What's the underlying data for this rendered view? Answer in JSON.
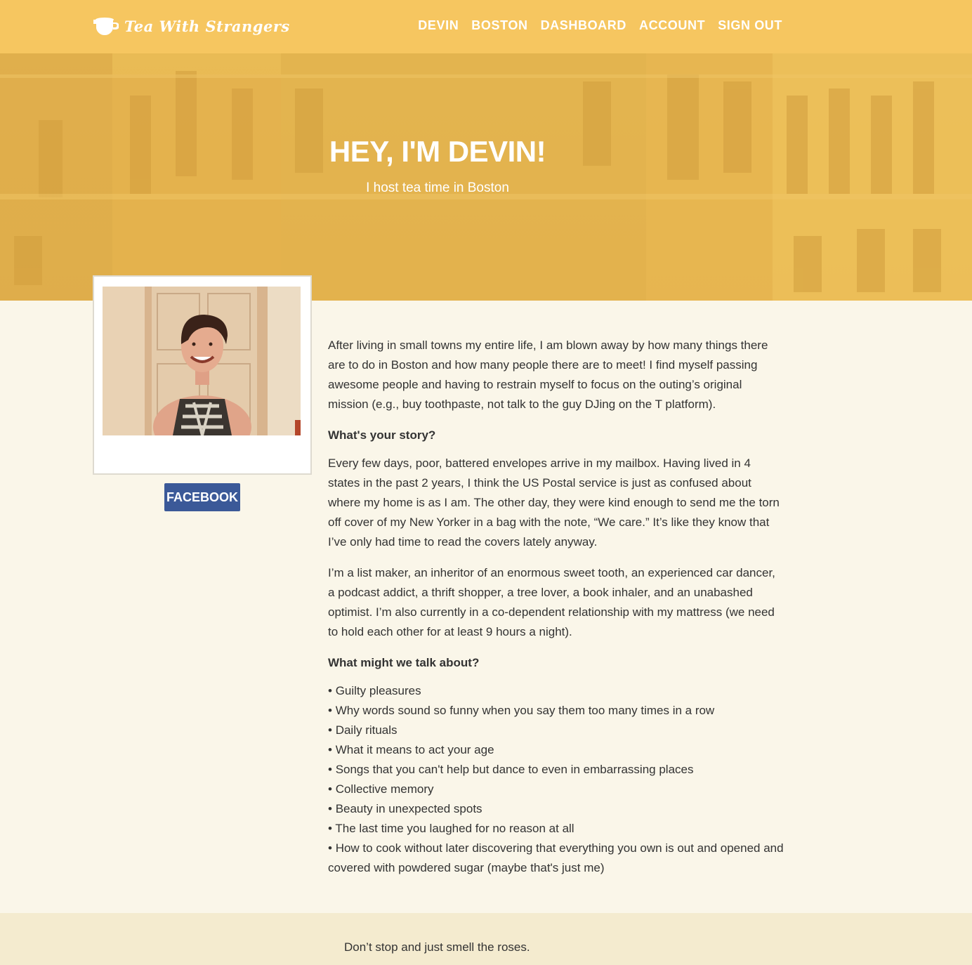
{
  "header": {
    "logo_text": "Tea With Strangers",
    "nav": [
      "DEVIN",
      "BOSTON",
      "DASHBOARD",
      "ACCOUNT",
      "SIGN OUT"
    ]
  },
  "hero": {
    "title": "HEY, I'M DEVIN!",
    "subtitle": "I host tea time in Boston"
  },
  "profile": {
    "facebook_label": "FACEBOOK"
  },
  "bio": {
    "intro": "After living in small towns my entire life, I am blown away by how many things there are to do in Boston and how many people there are to meet! I find myself passing awesome people and having to restrain myself to focus on the outing’s original mission (e.g., buy toothpaste, not talk to the guy DJing on the T platform).",
    "story_heading": "What's your story?",
    "story_p1": "Every few days, poor, battered envelopes arrive in my mailbox. Having lived in 4 states in the past 2 years, I think the US Postal service is just as confused about where my home is as I am. The other day, they were kind enough to send me the torn off cover of my New Yorker in a bag with the note, “We care.” It’s like they know that I’ve only had time to read the covers lately anyway.",
    "story_p2": "I’m a list maker, an inheritor of an enormous sweet tooth, an experienced car dancer, a podcast addict, a thrift shopper, a tree lover, a book inhaler, and an unabashed optimist. I’m also currently in a co-dependent relationship with my mattress (we need to hold each other for at least 9 hours a night).",
    "talk_heading": "What might we talk about?",
    "topics": [
      "Guilty pleasures",
      "Why words sound so funny when you say them too many times in a row",
      "Daily rituals",
      "What it means to act your age",
      "Songs that you can't help but dance to even in embarrassing places",
      "Collective memory",
      "Beauty in unexpected spots",
      "The last time you laughed for no reason at all",
      "How to cook without later discovering that everything you own is out and opened and covered with powdered sugar (maybe that's just me)"
    ]
  },
  "footer": {
    "quote": "Don’t stop and just smell the roses."
  },
  "colors": {
    "header_bg": "#f6c660",
    "hero_bg": "#e4b44e",
    "page_bg": "#faf6e9",
    "footer_bg": "#f4ebcf",
    "facebook_blue": "#3b5998"
  },
  "icons": {
    "logo": "teacup-icon"
  }
}
